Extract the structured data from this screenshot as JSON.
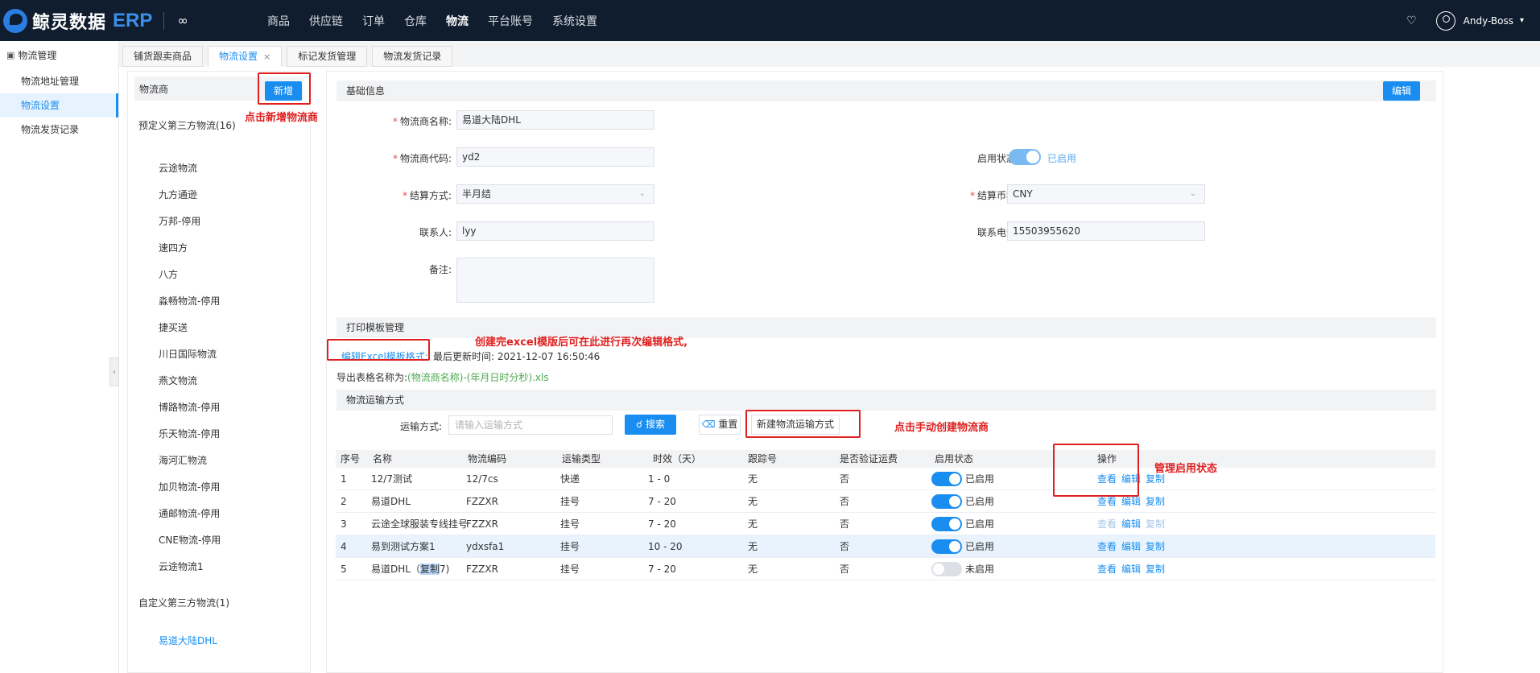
{
  "nav": {
    "brand_name": "鲸灵数据",
    "brand_suffix": "ERP",
    "menu": [
      "商品",
      "供应链",
      "订单",
      "仓库",
      "物流",
      "平台账号",
      "系统设置"
    ],
    "active_menu": "物流",
    "username": "Andy-Boss"
  },
  "sidebar": {
    "title": "物流管理",
    "items": [
      "物流地址管理",
      "物流设置",
      "物流发货记录"
    ],
    "active": "物流设置"
  },
  "tabs": [
    {
      "label": "铺货跟卖商品"
    },
    {
      "label": "物流设置",
      "active": true,
      "closable": true
    },
    {
      "label": "标记发货管理"
    },
    {
      "label": "物流发货记录"
    }
  ],
  "provider_panel": {
    "title": "物流商",
    "add_label": "新增",
    "predefined_title": "预定义第三方物流(16)",
    "predefined_items": [
      "云途物流",
      "九方通逊",
      "万邦-停用",
      "速四方",
      "八方",
      "淼畅物流-停用",
      "捷买送",
      "川日国际物流",
      "燕文物流",
      "博路物流-停用",
      "乐天物流-停用",
      "海河汇物流",
      "加贝物流-停用",
      "通邮物流-停用",
      "CNE物流-停用",
      "云途物流1"
    ],
    "custom_title": "自定义第三方物流(1)",
    "custom_items": [
      "易道大陆DHL"
    ]
  },
  "basic_info": {
    "title": "基础信息",
    "edit_label": "编辑",
    "name_label": "物流商名称:",
    "name_value": "易道大陆DHL",
    "code_label": "物流商代码:",
    "code_value": "yd2",
    "status_label": "启用状态:",
    "status_value": "已启用",
    "settle_label": "结算方式:",
    "settle_value": "半月结",
    "currency_label": "结算币种:",
    "currency_value": "CNY",
    "contact_label": "联系人:",
    "contact_value": "lyy",
    "phone_label": "联系电话:",
    "phone_value": "15503955620",
    "remark_label": "备注:"
  },
  "print_template": {
    "title": "打印模板管理",
    "edit_link": "编辑Excel模板格式:",
    "last_updated": "最后更新时间:  2021-12-07 16:50:46",
    "export_label": "导出表格名称为:",
    "export_value": "(物流商名称)-(年月日时分秒).xls"
  },
  "shipping": {
    "title": "物流运输方式",
    "search_label": "运输方式:",
    "search_placeholder": "请输入运输方式",
    "search_btn": "搜索",
    "reset_btn": "重置",
    "new_btn": "新建物流运输方式",
    "columns": [
      "序号",
      "名称",
      "物流编码",
      "运输类型",
      "时效（天）",
      "跟踪号",
      "是否验证运费",
      "启用状态",
      "操作"
    ],
    "rows": [
      {
        "idx": "1",
        "name": "12/7测试",
        "code": "12/7cs",
        "type": "快递",
        "days": "1 - 0",
        "track": "无",
        "verify": "否",
        "enabled": true,
        "status": "已启用"
      },
      {
        "idx": "2",
        "name": "易道DHL",
        "code": "FZZXR",
        "type": "挂号",
        "days": "7 - 20",
        "track": "无",
        "verify": "否",
        "enabled": true,
        "status": "已启用"
      },
      {
        "idx": "3",
        "name": "云途全球服装专线挂号",
        "code": "FZZXR",
        "type": "挂号",
        "days": "7 - 20",
        "track": "无",
        "verify": "否",
        "enabled": true,
        "status": "已启用"
      },
      {
        "idx": "4",
        "name": "易到测试方案1",
        "code": "ydxsfa1",
        "type": "挂号",
        "days": "10 - 20",
        "track": "无",
        "verify": "否",
        "enabled": true,
        "status": "已启用"
      },
      {
        "idx": "5",
        "name_prefix": "易道DHL（",
        "name_hl": "复制",
        "name_suffix": "7)",
        "code": "FZZXR",
        "type": "挂号",
        "days": "7 - 20",
        "track": "无",
        "verify": "否",
        "enabled": false,
        "status": "未启用"
      }
    ],
    "actions": [
      "查看",
      "编辑",
      "复制"
    ]
  },
  "annotations": {
    "add_hint": "点击新增物流商",
    "excel_hint": "创建完excel模版后可在此进行再次编辑格式,",
    "create_hint": "点击手动创建物流商",
    "status_hint": "管理启用状态"
  },
  "colors": {
    "nav_bg": "#0f1d2e",
    "primary": "#1a8ef0",
    "annotation": "#e02020",
    "export_green": "#49a94d"
  }
}
